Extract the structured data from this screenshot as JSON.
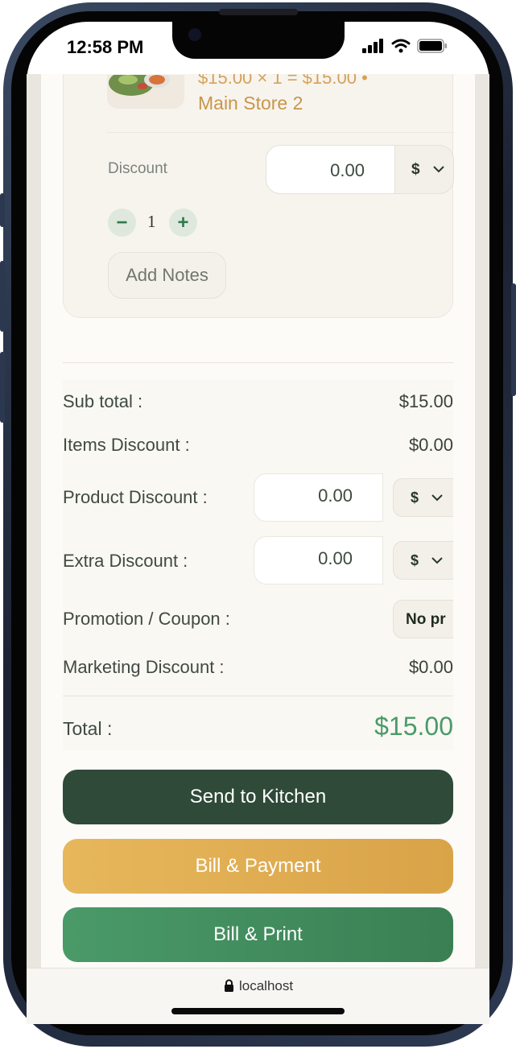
{
  "status_bar": {
    "time": "12:58 PM",
    "icons": [
      "cellular-signal-icon",
      "wifi-icon",
      "battery-icon"
    ]
  },
  "cart_item": {
    "price_line": "$15.00 × 1 = $15.00 •",
    "store": "Main Store 2",
    "discount_label": "Discount",
    "discount_value": "0.00",
    "discount_type": "$",
    "quantity": "1",
    "minus_label": "−",
    "plus_label": "+",
    "add_notes_label": "Add Notes"
  },
  "summary": {
    "subtotal_label": "Sub total :",
    "subtotal_value": "$15.00",
    "items_discount_label": "Items Discount :",
    "items_discount_value": "$0.00",
    "product_discount_label": "Product Discount :",
    "product_discount_value": "0.00",
    "product_discount_type": "$",
    "extra_discount_label": "Extra Discount :",
    "extra_discount_value": "0.00",
    "extra_discount_type": "$",
    "promotion_label": "Promotion / Coupon :",
    "promotion_value": "No pr",
    "marketing_discount_label": "Marketing Discount :",
    "marketing_discount_value": "$0.00",
    "total_label": "Total :",
    "total_value": "$15.00"
  },
  "actions": {
    "send_to_kitchen": "Send to Kitchen",
    "bill_payment": "Bill & Payment",
    "bill_print": "Bill & Print"
  },
  "browser": {
    "url": "localhost"
  },
  "colors": {
    "dark_green": "#2f4a38",
    "gold": "#dfac52",
    "green": "#4a9a68",
    "accent_text": "#c99549"
  }
}
